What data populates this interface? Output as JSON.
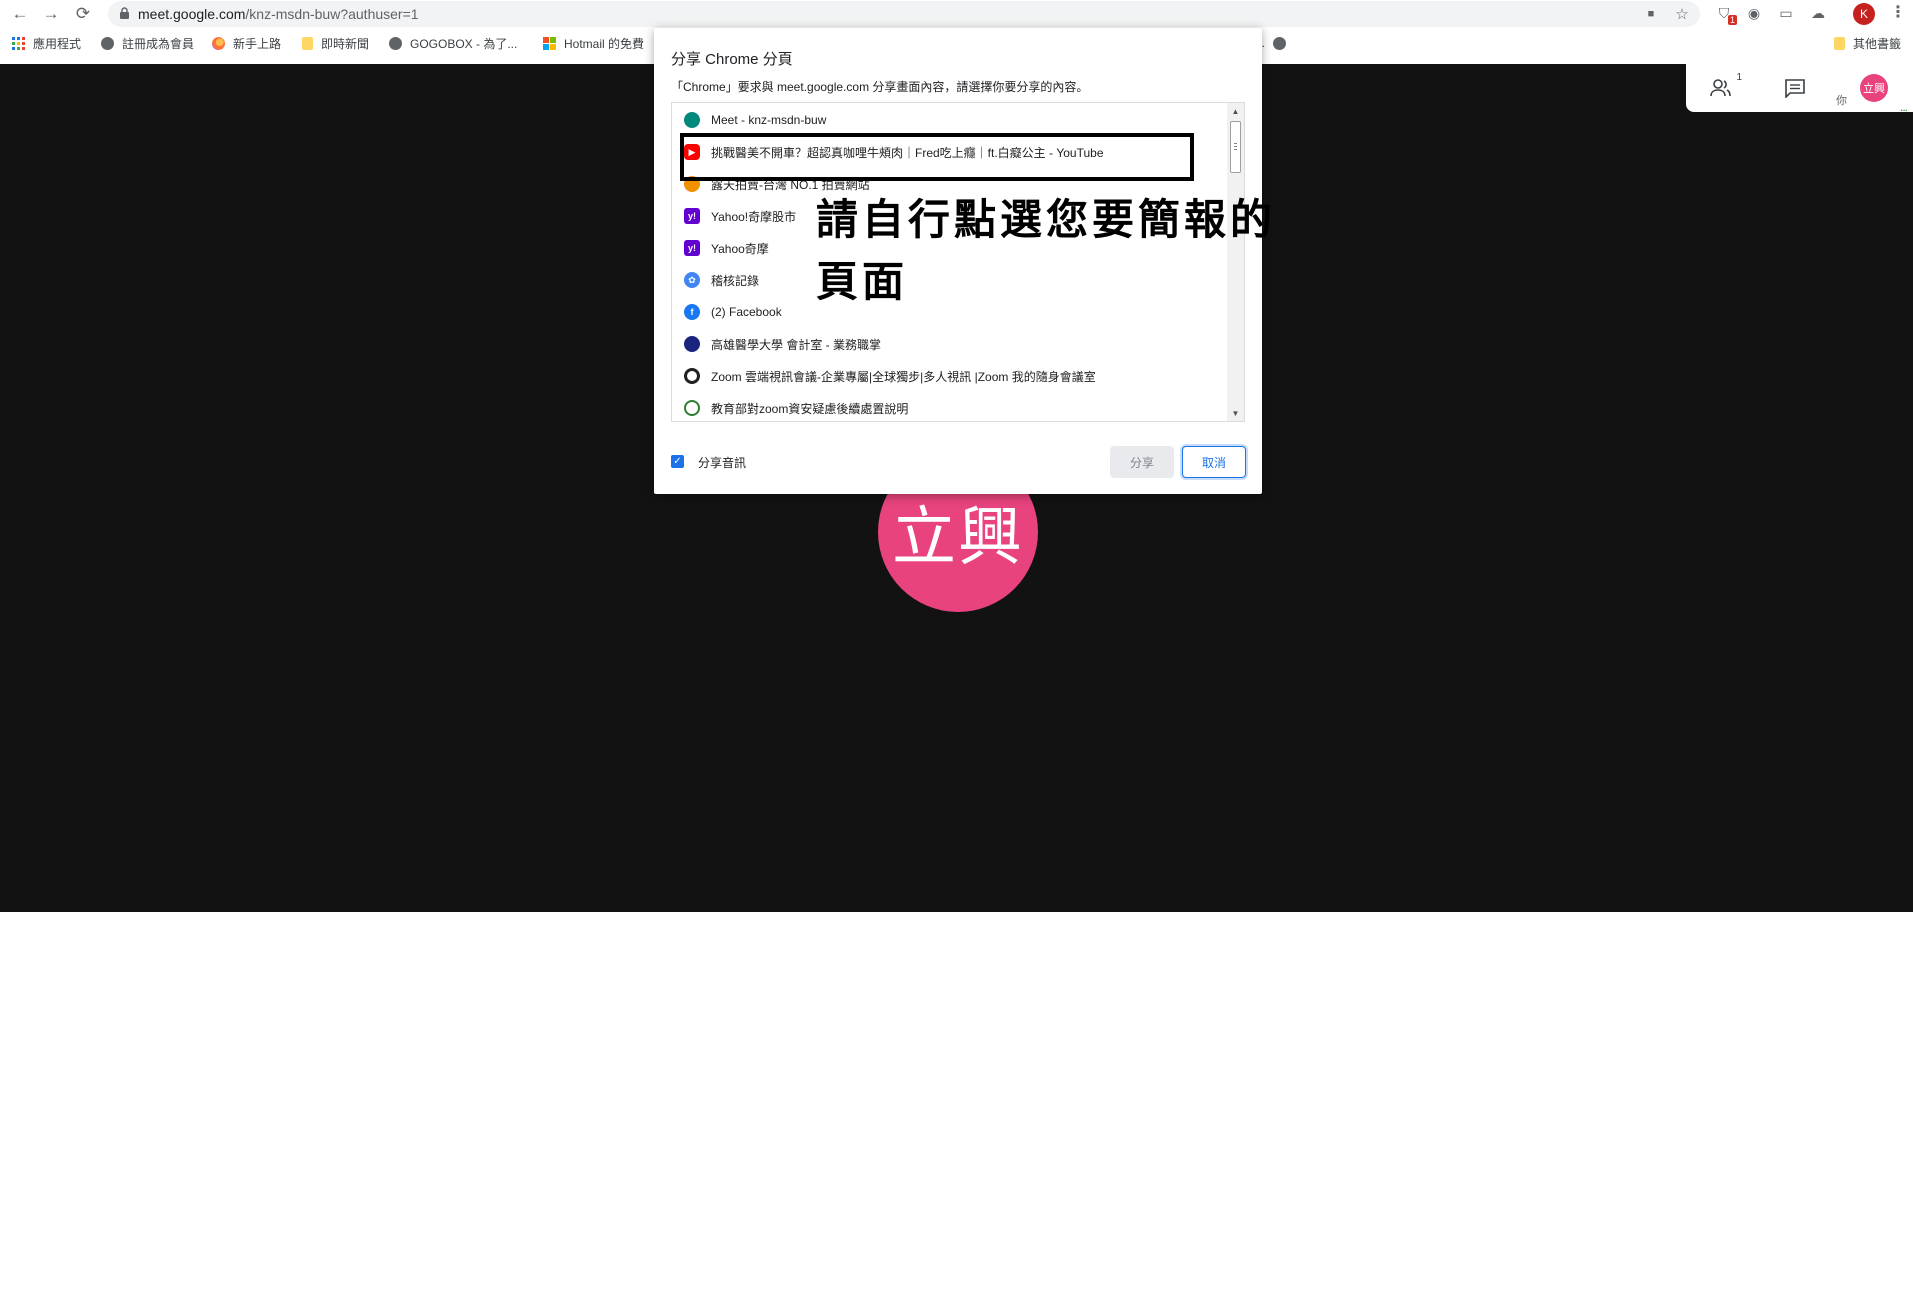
{
  "browser": {
    "url_main": "meet.google.com",
    "url_path": "/knz-msdn-buw?authuser=1",
    "nav": {
      "back": "←",
      "forward": "→",
      "reload": "⟳"
    },
    "omni_icons": {
      "camera": "■",
      "star": "☆"
    },
    "extensions": [
      {
        "name": "shield-extension-icon",
        "glyph": "⛉",
        "badge": "1"
      },
      {
        "name": "location-extension-icon",
        "glyph": "◉",
        "badge": ""
      },
      {
        "name": "cast-extension-icon",
        "glyph": "▭",
        "badge": ""
      },
      {
        "name": "cloud-extension-icon",
        "glyph": "☁",
        "badge": ""
      }
    ],
    "profile_initial": "K",
    "menu_glyph": "⋮",
    "bookmarks": [
      {
        "label": "應用程式",
        "icon": "apps-grid-icon"
      },
      {
        "label": "註冊成為會員",
        "icon": "globe-icon"
      },
      {
        "label": "新手上路",
        "icon": "firefox-icon"
      },
      {
        "label": "即時新聞",
        "icon": "folder-icon"
      },
      {
        "label": "GOGOBOX - 為了...",
        "icon": "globe-icon"
      },
      {
        "label": "Hotmail 的免費",
        "icon": "microsoft-icon"
      },
      {
        "label": "...",
        "icon": "globe-icon"
      },
      {
        "label": "其他書籤",
        "icon": "folder-icon"
      }
    ]
  },
  "meet": {
    "participants_count": "1",
    "you_label": "你",
    "self_initials": "立興",
    "speaking_indicator": "...",
    "main_avatar_text": "立興",
    "avatar_color": "#e8437e",
    "stage_color": "#121212"
  },
  "dialog": {
    "title": "分享 Chrome 分頁",
    "subtitle": "「Chrome」要求與 meet.google.com 分享畫面內容，請選擇你要分享的內容。",
    "tabs": [
      {
        "label": "Meet - knz-msdn-buw",
        "favicon": "meet-icon"
      },
      {
        "label": "挑戰醫美不開車？超認真咖哩牛頰肉｜Fred吃上癮｜ft.白癡公主 - YouTube",
        "favicon": "youtube-icon"
      },
      {
        "label": "露天拍賣-台灣 NO.1 拍賣網站",
        "favicon": "ruten-icon"
      },
      {
        "label": "Yahoo!奇摩股市",
        "favicon": "yahoo-icon"
      },
      {
        "label": "Yahoo奇摩",
        "favicon": "yahoo-icon"
      },
      {
        "label": "稽核記錄",
        "favicon": "audit-icon"
      },
      {
        "label": "(2) Facebook",
        "favicon": "facebook-icon"
      },
      {
        "label": "高雄醫學大學 會計室 - 業務職掌",
        "favicon": "kmu-icon"
      },
      {
        "label": "Zoom 雲端視訊會議-企業專屬|全球獨步|多人視訊 |Zoom 我的隨身會議室",
        "favicon": "zoom-icon"
      },
      {
        "label": "教育部對zoom資安疑慮後續處置說明",
        "favicon": "moe-icon"
      }
    ],
    "favicon_glyphs": {
      "youtube": "▶",
      "yahoo": "y!",
      "facebook": "f",
      "audit": "✿"
    },
    "scroll_arrows": {
      "up": "▲",
      "down": "▼"
    },
    "annotation": "請自行點選您要簡報的頁面",
    "share_audio_label": "分享音訊",
    "share_audio_checked": true,
    "checkmark": "✓",
    "share_button": "分享",
    "cancel_button": "取消"
  }
}
